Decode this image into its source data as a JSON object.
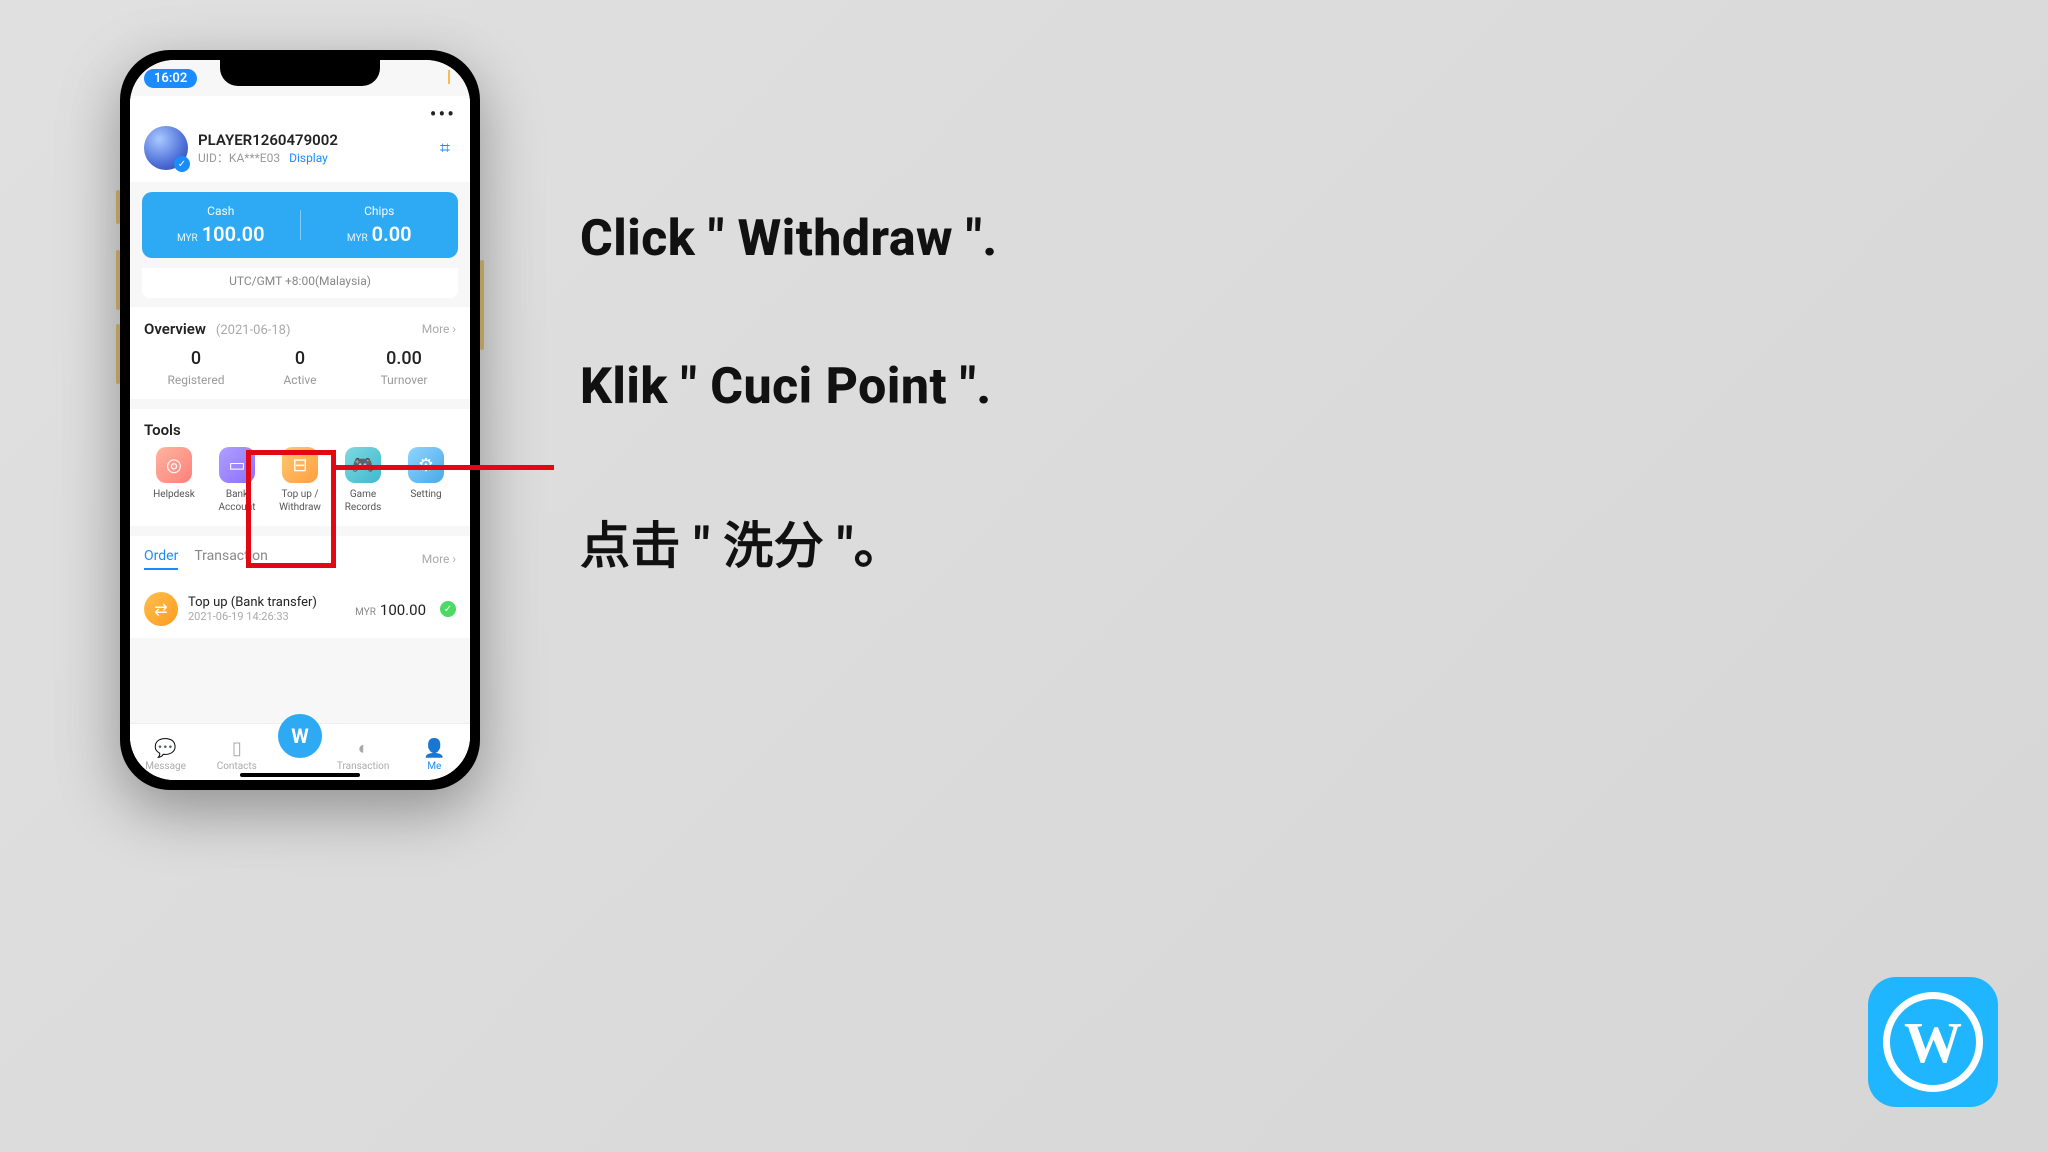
{
  "status": {
    "time": "16:02"
  },
  "profile": {
    "name": "PLAYER1260479002",
    "uid_prefix": "UID：",
    "uid": "KA***E03",
    "display": "Display"
  },
  "balance": {
    "cash_label": "Cash",
    "cash_cur": "MYR",
    "cash_amt": "100.00",
    "chips_label": "Chips",
    "chips_cur": "MYR",
    "chips_amt": "0.00"
  },
  "timezone": "UTC/GMT +8:00(Malaysia)",
  "overview": {
    "title": "Overview",
    "date": "(2021-06-18)",
    "more": "More",
    "registered_val": "0",
    "registered_lab": "Registered",
    "active_val": "0",
    "active_lab": "Active",
    "turnover_val": "0.00",
    "turnover_lab": "Turnover"
  },
  "tools": {
    "title": "Tools",
    "helpdesk": "Helpdesk",
    "bank": "Bank Account",
    "topup": "Top up / Withdraw",
    "game": "Game Records",
    "setting": "Setting"
  },
  "orders": {
    "tab_order": "Order",
    "tab_txn": "Transaction",
    "more": "More",
    "row_title": "Top up (Bank transfer)",
    "row_time": "2021-06-19 14:26:33",
    "row_cur": "MYR",
    "row_amt": "100.00"
  },
  "nav": {
    "message": "Message",
    "contacts": "Contacts",
    "center": "W",
    "transaction": "Transaction",
    "me": "Me"
  },
  "instructions": {
    "en": "Click \" Withdraw \".",
    "ms": "Klik \" Cuci Point \".",
    "zh": "点击 \" 洗分 \"。"
  },
  "logo_letter": "W"
}
